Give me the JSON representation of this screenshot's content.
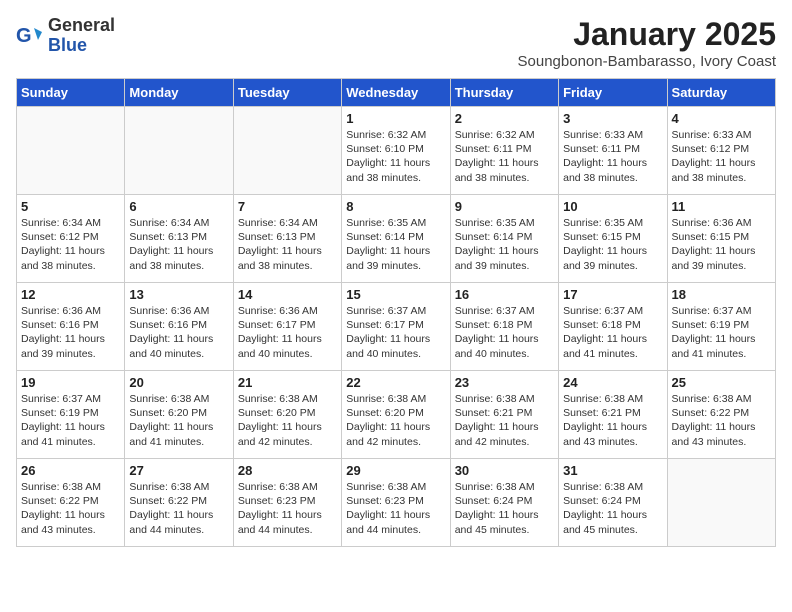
{
  "header": {
    "logo_general": "General",
    "logo_blue": "Blue",
    "month_title": "January 2025",
    "location": "Soungbonon-Bambarasso, Ivory Coast"
  },
  "days_of_week": [
    "Sunday",
    "Monday",
    "Tuesday",
    "Wednesday",
    "Thursday",
    "Friday",
    "Saturday"
  ],
  "weeks": [
    [
      {
        "day": "",
        "info": ""
      },
      {
        "day": "",
        "info": ""
      },
      {
        "day": "",
        "info": ""
      },
      {
        "day": "1",
        "info": "Sunrise: 6:32 AM\nSunset: 6:10 PM\nDaylight: 11 hours and 38 minutes."
      },
      {
        "day": "2",
        "info": "Sunrise: 6:32 AM\nSunset: 6:11 PM\nDaylight: 11 hours and 38 minutes."
      },
      {
        "day": "3",
        "info": "Sunrise: 6:33 AM\nSunset: 6:11 PM\nDaylight: 11 hours and 38 minutes."
      },
      {
        "day": "4",
        "info": "Sunrise: 6:33 AM\nSunset: 6:12 PM\nDaylight: 11 hours and 38 minutes."
      }
    ],
    [
      {
        "day": "5",
        "info": "Sunrise: 6:34 AM\nSunset: 6:12 PM\nDaylight: 11 hours and 38 minutes."
      },
      {
        "day": "6",
        "info": "Sunrise: 6:34 AM\nSunset: 6:13 PM\nDaylight: 11 hours and 38 minutes."
      },
      {
        "day": "7",
        "info": "Sunrise: 6:34 AM\nSunset: 6:13 PM\nDaylight: 11 hours and 38 minutes."
      },
      {
        "day": "8",
        "info": "Sunrise: 6:35 AM\nSunset: 6:14 PM\nDaylight: 11 hours and 39 minutes."
      },
      {
        "day": "9",
        "info": "Sunrise: 6:35 AM\nSunset: 6:14 PM\nDaylight: 11 hours and 39 minutes."
      },
      {
        "day": "10",
        "info": "Sunrise: 6:35 AM\nSunset: 6:15 PM\nDaylight: 11 hours and 39 minutes."
      },
      {
        "day": "11",
        "info": "Sunrise: 6:36 AM\nSunset: 6:15 PM\nDaylight: 11 hours and 39 minutes."
      }
    ],
    [
      {
        "day": "12",
        "info": "Sunrise: 6:36 AM\nSunset: 6:16 PM\nDaylight: 11 hours and 39 minutes."
      },
      {
        "day": "13",
        "info": "Sunrise: 6:36 AM\nSunset: 6:16 PM\nDaylight: 11 hours and 40 minutes."
      },
      {
        "day": "14",
        "info": "Sunrise: 6:36 AM\nSunset: 6:17 PM\nDaylight: 11 hours and 40 minutes."
      },
      {
        "day": "15",
        "info": "Sunrise: 6:37 AM\nSunset: 6:17 PM\nDaylight: 11 hours and 40 minutes."
      },
      {
        "day": "16",
        "info": "Sunrise: 6:37 AM\nSunset: 6:18 PM\nDaylight: 11 hours and 40 minutes."
      },
      {
        "day": "17",
        "info": "Sunrise: 6:37 AM\nSunset: 6:18 PM\nDaylight: 11 hours and 41 minutes."
      },
      {
        "day": "18",
        "info": "Sunrise: 6:37 AM\nSunset: 6:19 PM\nDaylight: 11 hours and 41 minutes."
      }
    ],
    [
      {
        "day": "19",
        "info": "Sunrise: 6:37 AM\nSunset: 6:19 PM\nDaylight: 11 hours and 41 minutes."
      },
      {
        "day": "20",
        "info": "Sunrise: 6:38 AM\nSunset: 6:20 PM\nDaylight: 11 hours and 41 minutes."
      },
      {
        "day": "21",
        "info": "Sunrise: 6:38 AM\nSunset: 6:20 PM\nDaylight: 11 hours and 42 minutes."
      },
      {
        "day": "22",
        "info": "Sunrise: 6:38 AM\nSunset: 6:20 PM\nDaylight: 11 hours and 42 minutes."
      },
      {
        "day": "23",
        "info": "Sunrise: 6:38 AM\nSunset: 6:21 PM\nDaylight: 11 hours and 42 minutes."
      },
      {
        "day": "24",
        "info": "Sunrise: 6:38 AM\nSunset: 6:21 PM\nDaylight: 11 hours and 43 minutes."
      },
      {
        "day": "25",
        "info": "Sunrise: 6:38 AM\nSunset: 6:22 PM\nDaylight: 11 hours and 43 minutes."
      }
    ],
    [
      {
        "day": "26",
        "info": "Sunrise: 6:38 AM\nSunset: 6:22 PM\nDaylight: 11 hours and 43 minutes."
      },
      {
        "day": "27",
        "info": "Sunrise: 6:38 AM\nSunset: 6:22 PM\nDaylight: 11 hours and 44 minutes."
      },
      {
        "day": "28",
        "info": "Sunrise: 6:38 AM\nSunset: 6:23 PM\nDaylight: 11 hours and 44 minutes."
      },
      {
        "day": "29",
        "info": "Sunrise: 6:38 AM\nSunset: 6:23 PM\nDaylight: 11 hours and 44 minutes."
      },
      {
        "day": "30",
        "info": "Sunrise: 6:38 AM\nSunset: 6:24 PM\nDaylight: 11 hours and 45 minutes."
      },
      {
        "day": "31",
        "info": "Sunrise: 6:38 AM\nSunset: 6:24 PM\nDaylight: 11 hours and 45 minutes."
      },
      {
        "day": "",
        "info": ""
      }
    ]
  ]
}
